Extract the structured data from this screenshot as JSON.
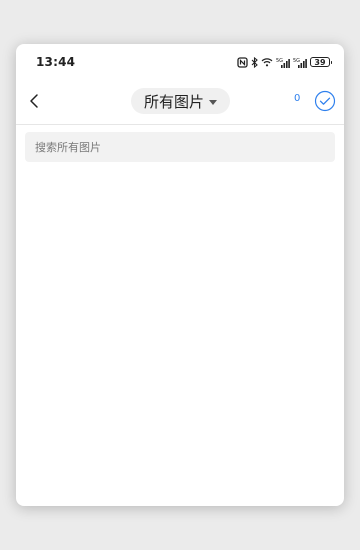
{
  "status_bar": {
    "time": "13:44",
    "battery": "39",
    "icons": [
      "nfc-icon",
      "bluetooth-icon",
      "wifi-icon",
      "signal-5g-icon",
      "signal-5g-icon",
      "battery-icon"
    ]
  },
  "header": {
    "title": "所有图片",
    "selected_count": "0",
    "accent_color": "#2f80ed"
  },
  "search": {
    "placeholder": "搜索所有图片",
    "value": ""
  }
}
